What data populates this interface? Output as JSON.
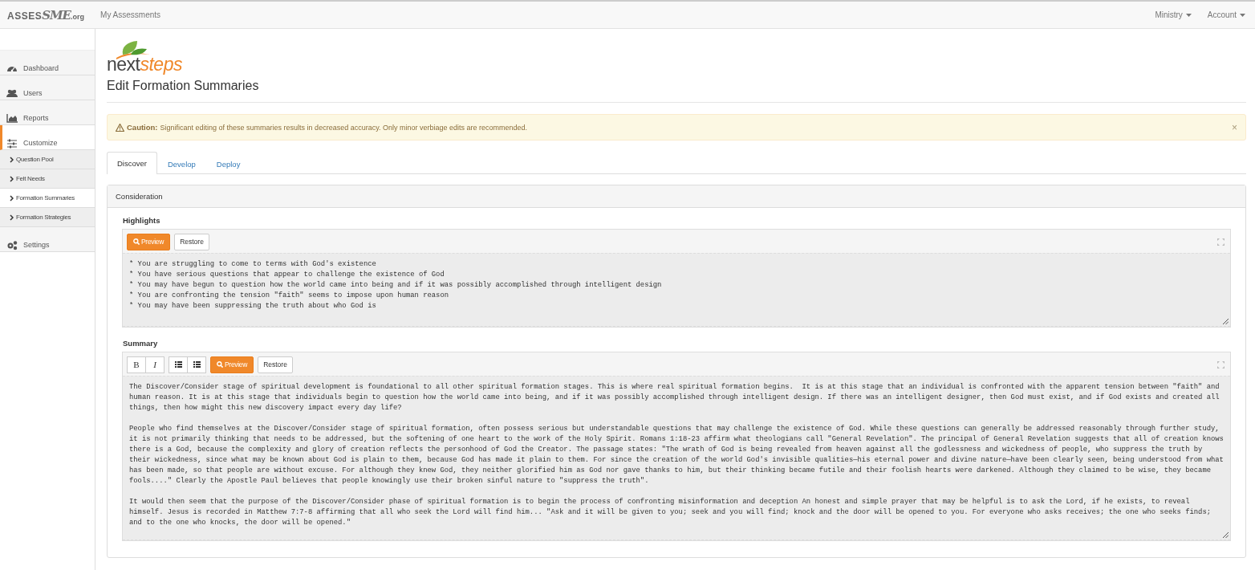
{
  "navbar": {
    "logo": {
      "prefix": "ASSES",
      "mark": "SME",
      "suffix": ".org"
    },
    "links": [
      "My Assessments"
    ],
    "menus": [
      "Ministry",
      "Account"
    ]
  },
  "sidebar": {
    "items": [
      {
        "kind": "main",
        "label": "Dashboard",
        "selected": false
      },
      {
        "kind": "main",
        "label": "Users",
        "selected": false
      },
      {
        "kind": "main",
        "label": "Reports",
        "selected": false
      },
      {
        "kind": "main",
        "label": "Customize",
        "selected": true
      },
      {
        "kind": "sub",
        "label": "Question Pool",
        "selected": false
      },
      {
        "kind": "sub",
        "label": "Felt Needs",
        "selected": false
      },
      {
        "kind": "sub",
        "label": "Formation Summaries",
        "selected": true
      },
      {
        "kind": "sub",
        "label": "Formation Strategies",
        "selected": false
      },
      {
        "kind": "main",
        "label": "Settings",
        "selected": false
      }
    ]
  },
  "brand": {
    "first": "next",
    "second": "steps"
  },
  "page_title": "Edit Formation Summaries",
  "alert": {
    "label": "Caution:",
    "message": "Significant editing of these summaries results in decreased accuracy. Only minor verbiage edits are recommended.",
    "close": "×"
  },
  "tabs": [
    {
      "label": "Discover",
      "selected": true
    },
    {
      "label": "Develop",
      "selected": false
    },
    {
      "label": "Deploy",
      "selected": false
    }
  ],
  "panel": {
    "title": "Consideration",
    "editors": [
      {
        "label": "Highlights",
        "toolbar": [
          {
            "kind": "preview",
            "label": "Preview"
          },
          {
            "kind": "restore",
            "label": "Restore"
          }
        ],
        "paragraphs": [
          "* You are struggling to come to terms with God's existence\n* You have serious questions that appear to challenge the existence of God\n* You may have begun to question how the world came into being and if it was possibly accomplished through intelligent design\n* You are confronting the tension \"faith\" seems to impose upon human reason\n* You may have been suppressing the truth about who God is"
        ]
      },
      {
        "label": "Summary",
        "toolbar": [
          {
            "kind": "bold",
            "label": "B"
          },
          {
            "kind": "italic",
            "label": "I"
          },
          {
            "kind": "list"
          },
          {
            "kind": "numbered"
          },
          {
            "kind": "preview",
            "label": "Preview"
          },
          {
            "kind": "restore",
            "label": "Restore"
          }
        ],
        "paragraphs": [
          "The Discover/Consider stage of spiritual development is foundational to all other spiritual formation stages. This is where real spiritual formation begins.  It is at this stage that an individual is confronted with the apparent tension between \"faith\" and human reason. It is at this stage that individuals begin to question how the world came into being, and if it was possibly accomplished through intelligent design. If there was an intelligent designer, then God must exist, and if God exists and created all things, then how might this new discovery impact every day life?",
          "People who find themselves at the Discover/Consider stage of spiritual formation, often possess serious but understandable questions that may challenge the existence of God. While these questions can generally be addressed reasonably through further study, it is not primarily thinking that needs to be addressed, but the softening of one heart to the work of the Holy Spirit. Romans 1:18-23 affirm what theologians call \"General Revelation\". The principal of General Revelation suggests that all of creation knows there is a God, because the complexity and glory of creation reflects the personhood of God the Creator. The passage states: \"The wrath of God is being revealed from heaven against all the godlessness and wickedness of people, who suppress the truth by their wickedness, since what may be known about God is plain to them, because God has made it plain to them. For since the creation of the world God's invisible qualities—his eternal power and divine nature—have been clearly seen, being understood from what has been made, so that people are without excuse. For although they knew God, they neither glorified him as God nor gave thanks to him, but their thinking became futile and their foolish hearts were darkened. Although they claimed to be wise, they became fools....\" Clearly the Apostle Paul believes that people knowingly use their broken sinful nature to \"suppress the truth\".",
          "It would then seem that the purpose of the Discover/Consider phase of spiritual formation is to begin the process of confronting misinformation and deception An honest and simple prayer that may be helpful is to ask the Lord, if he exists, to reveal himself. Jesus is recorded in Matthew 7:7-8 affirming that all who seek the Lord will find him... \"Ask and it will be given to you; seek and you will find; knock and the door will be opened to you. For everyone who asks receives; the one who seeks finds; and to the one who knocks, the door will be opened.\""
        ]
      }
    ]
  }
}
